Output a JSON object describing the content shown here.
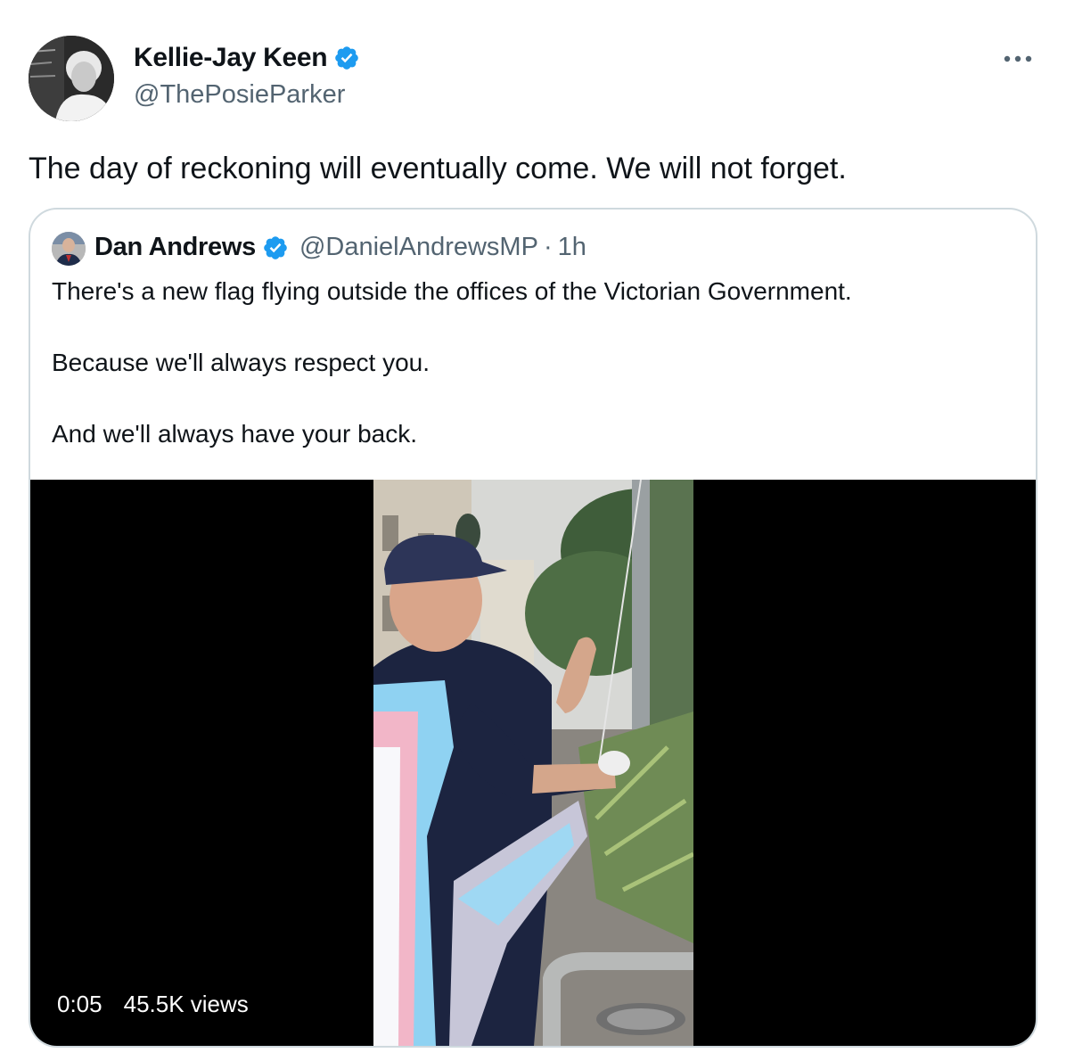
{
  "tweet": {
    "author": {
      "display_name": "Kellie-Jay Keen",
      "handle": "@ThePosieParker",
      "verified": true,
      "avatar_icon": "profile-photo"
    },
    "text": "The day of reckoning will eventually come. We will not forget.",
    "more_icon": "ellipsis-icon"
  },
  "quoted_tweet": {
    "author": {
      "display_name": "Dan Andrews",
      "handle": "@DanielAndrewsMP",
      "time_sep": "·",
      "time": "1h",
      "verified": true
    },
    "lines": [
      "There's a new flag flying outside the offices of the Victorian Government.",
      "Because we'll always respect you.",
      "And we'll always have your back."
    ],
    "video": {
      "timestamp": "0:05",
      "views": "45.5K views"
    }
  },
  "colors": {
    "verified_blue": "#1d9bf0",
    "secondary_text": "#536471",
    "border": "#cfd9de",
    "flag_blue": "#8fd2f2",
    "flag_pink": "#f2b6c8"
  }
}
